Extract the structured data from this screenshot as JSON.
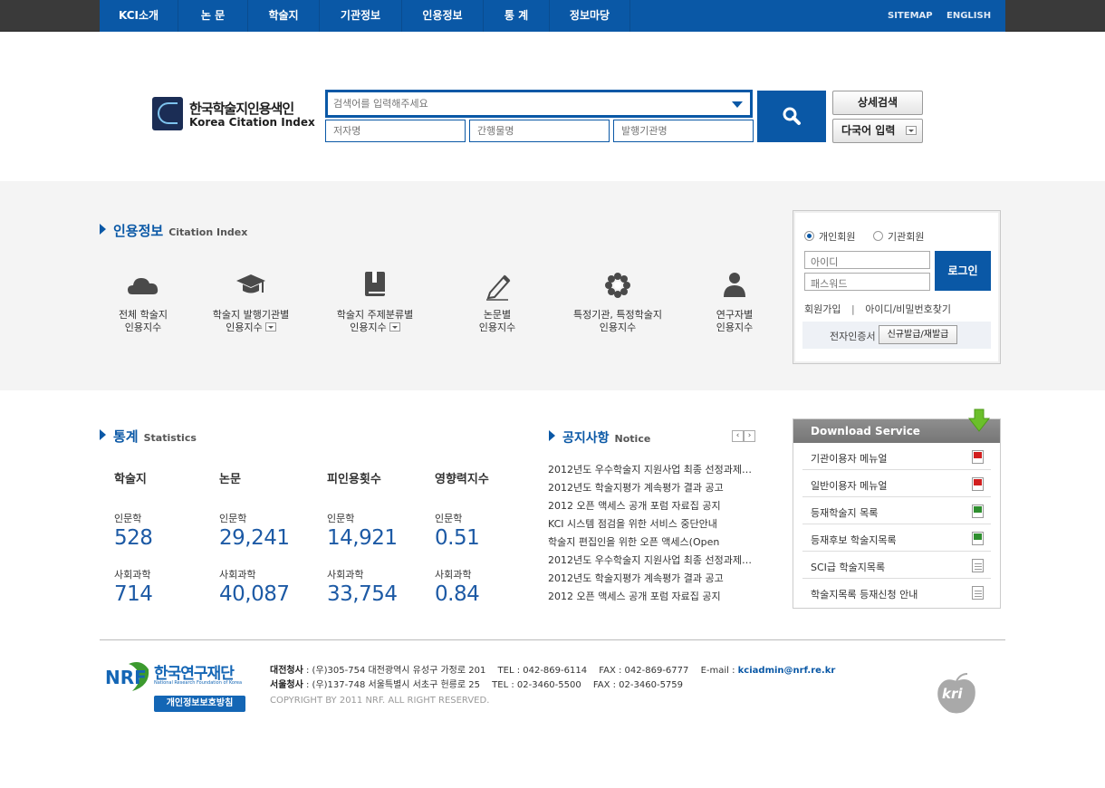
{
  "nav": {
    "items": [
      "KCI소개",
      "논 문",
      "학술지",
      "기관정보",
      "인용정보",
      "통 계",
      "정보마당"
    ],
    "sitemap": "SITEMAP",
    "english": "ENGLISH"
  },
  "logo": {
    "kr": "한국학술지인용색인",
    "en": "Korea Citation Index"
  },
  "search": {
    "main_placeholder": "검색어를 입력해주세요",
    "author_placeholder": "저자명",
    "journal_placeholder": "간행물명",
    "publisher_placeholder": "발행기관명",
    "advanced_label": "상세검색",
    "multilang_label": "다국어 입력"
  },
  "citation": {
    "title": "인용정보",
    "title_en": "Citation Index",
    "items": [
      {
        "line1": "전체 학술지",
        "line2": "인용지수",
        "icon": "cloud-icon"
      },
      {
        "line1": "학술지 발행기관별",
        "line2": "인용지수",
        "icon": "graduation-cap-icon"
      },
      {
        "line1": "학술지 주제분류별",
        "line2": "인용지수",
        "icon": "book-icon"
      },
      {
        "line1": "논문별",
        "line2": "인용지수",
        "icon": "pen-icon"
      },
      {
        "line1": "특정기관, 특정학술지",
        "line2": "인용지수",
        "icon": "flower-icon"
      },
      {
        "line1": "연구자별",
        "line2": "인용지수",
        "icon": "person-icon"
      }
    ]
  },
  "login": {
    "personal": "개인회원",
    "institution": "기관회원",
    "id_placeholder": "아이디",
    "pw_placeholder": "패스워드",
    "button": "로그인",
    "join": "회원가입",
    "sep": "|",
    "find": "아이디/비밀번호찾기",
    "cert_label": "전자인증서",
    "cert_button": "신규발급/재발급"
  },
  "stats": {
    "title": "통계",
    "title_en": "Statistics",
    "columns": [
      {
        "head": "학술지",
        "a_label": "인문학",
        "a_value": "528",
        "b_label": "사회과학",
        "b_value": "714"
      },
      {
        "head": "논문",
        "a_label": "인문학",
        "a_value": "29,241",
        "b_label": "사회과학",
        "b_value": "40,087"
      },
      {
        "head": "피인용횟수",
        "a_label": "인문학",
        "a_value": "14,921",
        "b_label": "사회과학",
        "b_value": "33,754"
      },
      {
        "head": "영향력지수",
        "a_label": "인문학",
        "a_value": "0.51",
        "b_label": "사회과학",
        "b_value": "0.84"
      }
    ]
  },
  "notice": {
    "title": "공지사항",
    "title_en": "Notice",
    "items": [
      "2012년도 우수학술지 지원사업 최종 선정과제…",
      "2012년도 학술지평가 계속평가 결과 공고",
      "2012 오픈 액세스 공개 포럼 자료집 공지",
      "KCI 시스템 점검을 위한 서비스 중단안내",
      "학술지 편집인을 위한 오픈 액세스(Open",
      "2012년도 우수학술지 지원사업 최종 선정과제…",
      "2012년도 학술지평가 계속평가 결과 공고",
      "2012 오픈 액세스 공개 포럼 자료집 공지"
    ]
  },
  "download": {
    "title": "Download Service",
    "items": [
      {
        "label": "기관이용자 메뉴얼",
        "type": "pdf"
      },
      {
        "label": "일반이용자 메뉴얼",
        "type": "pdf"
      },
      {
        "label": "등재학술지 목록",
        "type": "xls"
      },
      {
        "label": "등재후보 학술지목록",
        "type": "xls"
      },
      {
        "label": "SCI급 학술지목록",
        "type": "doc"
      },
      {
        "label": "학술지목록 등재신청 안내",
        "type": "doc"
      }
    ]
  },
  "footer": {
    "nrf_kr": "한국연구재단",
    "nrf_en": "National Research Foundation of Korea",
    "privacy": "개인정보보호방침",
    "daejeon_label": "대전청사",
    "daejeon_addr": " : (우)305-754 대전광역시 유성구 가정로 201",
    "daejeon_tel": "TEL : 042-869-6114",
    "daejeon_fax": "FAX : 042-869-6777",
    "email_label": "E-mail : ",
    "email": "kciadmin@nrf.re.kr",
    "seoul_label": "서울청사",
    "seoul_addr": " : (우)137-748 서울특별시 서초구 헌릉로 25",
    "seoul_tel": "TEL : 02-3460-5500",
    "seoul_fax": "FAX : 02-3460-5759",
    "copyright": "COPYRIGHT BY 2011 NRF. ALL RIGHT RESERVED.",
    "kri": "kri"
  },
  "colors": {
    "primary": "#0a58a6",
    "topbar": "#3a3a3a",
    "band": "#f4f4f4",
    "value": "#1d5aa5"
  }
}
